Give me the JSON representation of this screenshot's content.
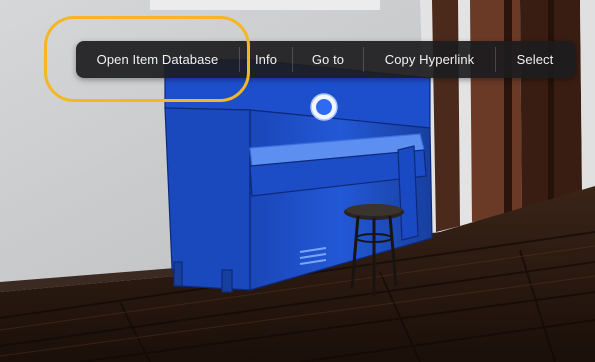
{
  "context_menu": {
    "items": [
      {
        "label": "Open Item Database"
      },
      {
        "label": "Info"
      },
      {
        "label": "Go to"
      },
      {
        "label": "Copy Hyperlink"
      },
      {
        "label": "Select"
      }
    ],
    "background": "#1c1c1e"
  },
  "scene": {
    "selected_object": "piano",
    "selection_color": "#1f5fd6",
    "highlight_color": "#f5b623",
    "icons": [
      "location-pin-icon"
    ]
  }
}
